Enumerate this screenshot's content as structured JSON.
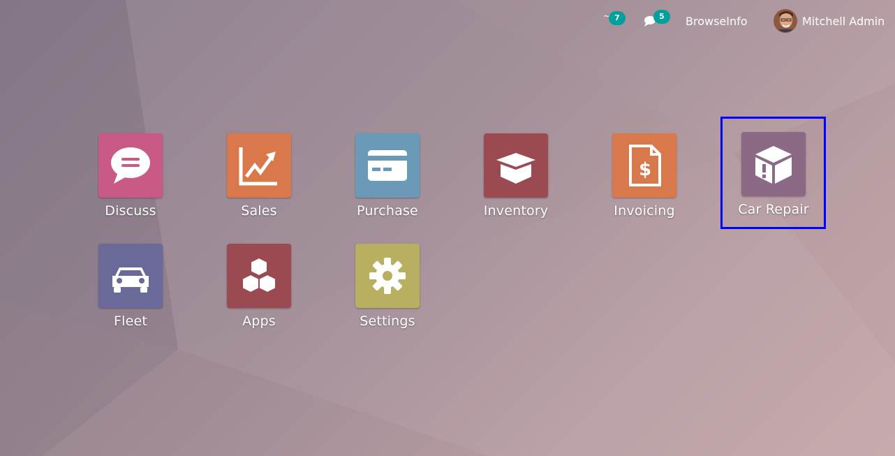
{
  "systray": {
    "activity_count": "7",
    "messages_count": "5",
    "company": "BrowseInfo",
    "user": "Mitchell Admin"
  },
  "apps": [
    {
      "label": "Discuss",
      "icon": "chat-bubble-icon",
      "color": "#c85a85"
    },
    {
      "label": "Sales",
      "icon": "trend-chart-icon",
      "color": "#d9784a"
    },
    {
      "label": "Purchase",
      "icon": "credit-card-icon",
      "color": "#6a9ab8"
    },
    {
      "label": "Inventory",
      "icon": "open-box-icon",
      "color": "#9c4a52"
    },
    {
      "label": "Invoicing",
      "icon": "invoice-dollar-icon",
      "color": "#d9784a"
    },
    {
      "label": "Car Repair",
      "icon": "box-exclamation-icon",
      "color": "#8c6a86"
    },
    {
      "label": "Fleet",
      "icon": "car-icon",
      "color": "#6a6a9a"
    },
    {
      "label": "Apps",
      "icon": "cubes-icon",
      "color": "#9c4a52"
    },
    {
      "label": "Settings",
      "icon": "gear-icon",
      "color": "#b8b060"
    }
  ]
}
